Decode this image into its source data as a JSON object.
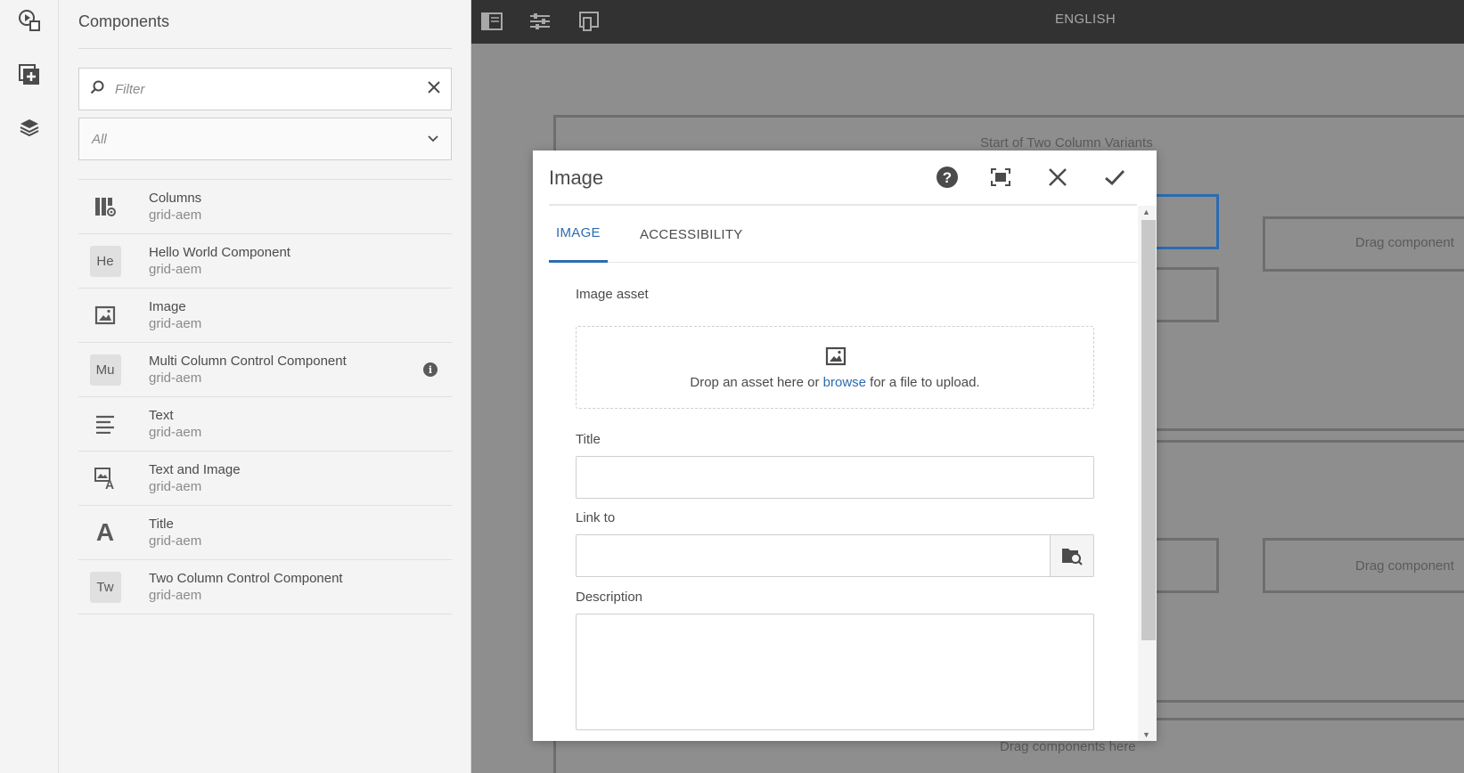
{
  "rail": {
    "icons": [
      "preview-play-icon",
      "add-component-icon",
      "layers-icon"
    ]
  },
  "panel": {
    "title": "Components",
    "filter_placeholder": "Filter",
    "group_select_value": "All",
    "items": [
      {
        "name": "Columns",
        "group": "grid-aem",
        "icon": "columns-icon"
      },
      {
        "name": "Hello World Component",
        "group": "grid-aem",
        "abbr": "He"
      },
      {
        "name": "Image",
        "group": "grid-aem",
        "icon": "image-icon"
      },
      {
        "name": "Multi Column Control Component",
        "group": "grid-aem",
        "abbr": "Mu",
        "info": "i"
      },
      {
        "name": "Text",
        "group": "grid-aem",
        "icon": "text-align-icon"
      },
      {
        "name": "Text and Image",
        "group": "grid-aem",
        "icon": "text-image-icon"
      },
      {
        "name": "Title",
        "group": "grid-aem",
        "icon": "title-icon",
        "glyph": "A"
      },
      {
        "name": "Two Column Control Component",
        "group": "grid-aem",
        "abbr": "Tw"
      }
    ]
  },
  "topbar": {
    "language": "ENGLISH"
  },
  "canvas": {
    "start_variants": "Start of Two Column Variants",
    "drag_short": "Drag component",
    "drag_full": "Drag components here"
  },
  "dialog": {
    "title": "Image",
    "tabs": [
      "IMAGE",
      "ACCESSIBILITY"
    ],
    "active_tab": "IMAGE",
    "image_asset_label": "Image asset",
    "drop_prefix": "Drop an asset here or ",
    "drop_link": "browse",
    "drop_suffix": " for a file to upload.",
    "title_label": "Title",
    "title_value": "",
    "link_label": "Link to",
    "link_value": "",
    "description_label": "Description",
    "description_value": ""
  },
  "colors": {
    "accent": "#2c6bb0",
    "topbar": "#323232",
    "overlay": "#8e8e8e"
  }
}
